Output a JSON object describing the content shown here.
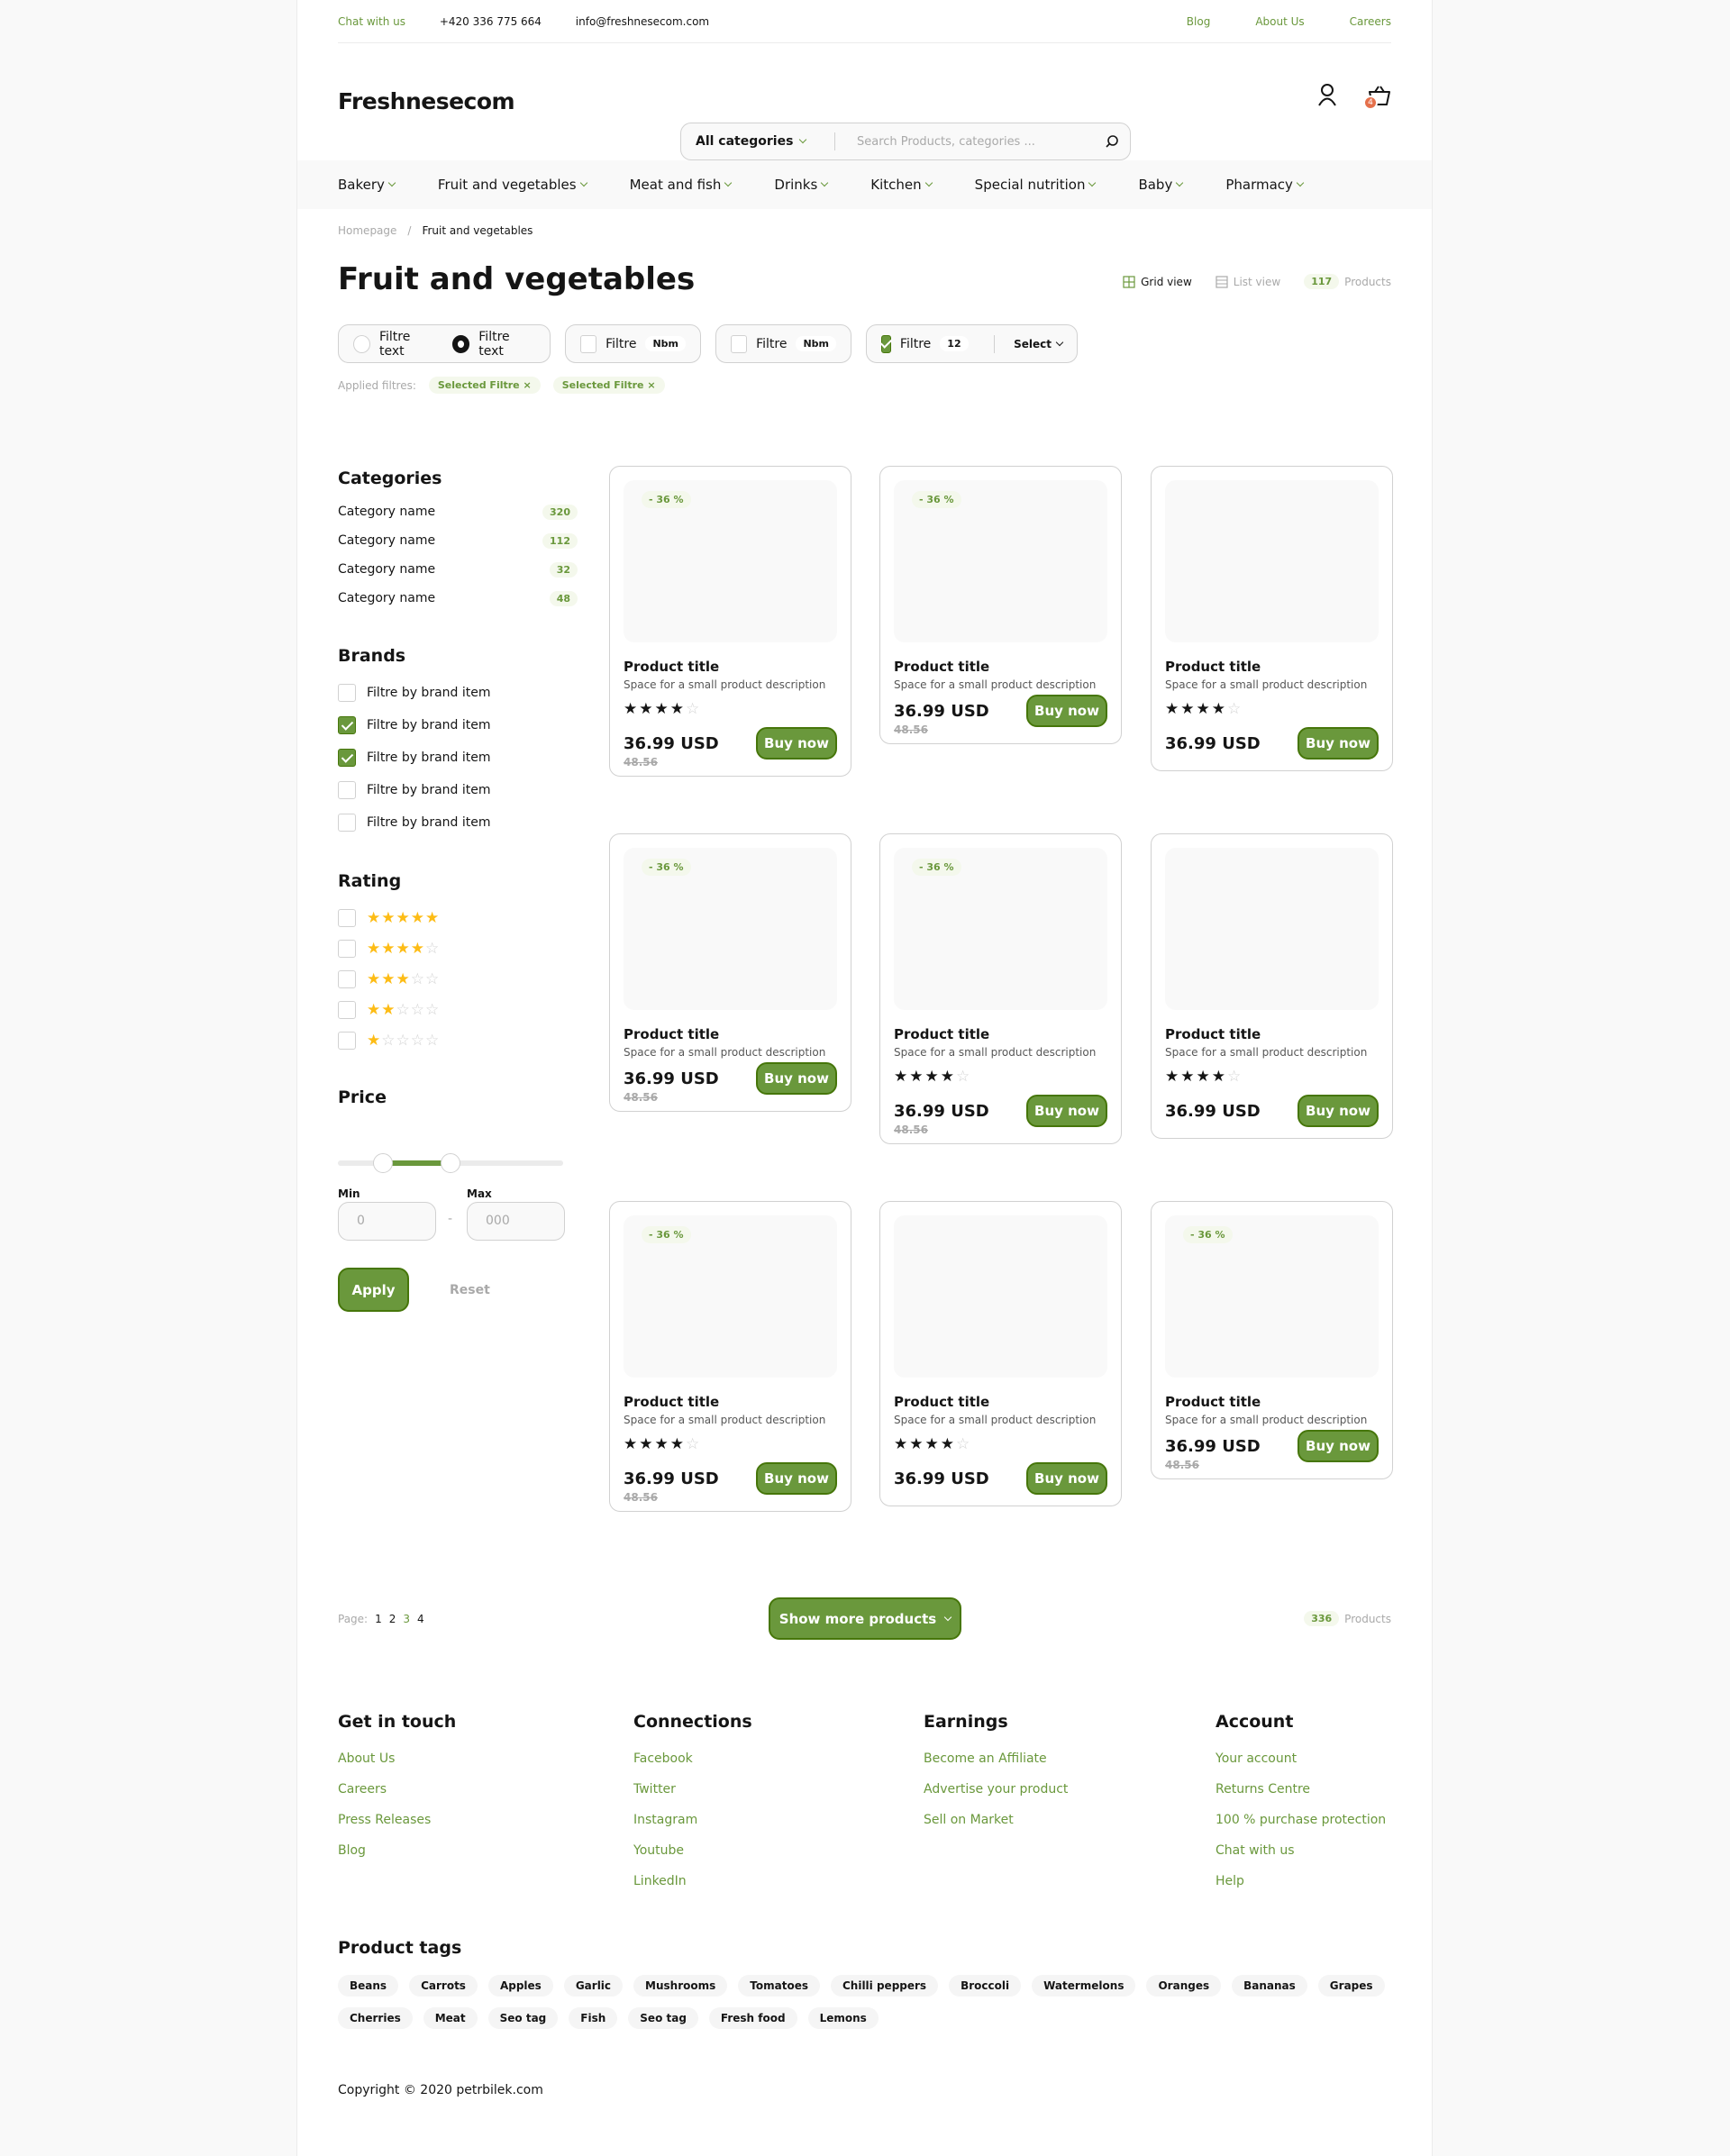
{
  "topbar": {
    "chat": "Chat with us",
    "phone": "+420 336 775 664",
    "email": "info@freshnesecom.com",
    "links": [
      "Blog",
      "About Us",
      "Careers"
    ]
  },
  "brand": "Freshnesecom",
  "search": {
    "category": "All categories",
    "placeholder": "Search Products, categories ..."
  },
  "cart_count": "4",
  "nav": [
    "Bakery",
    "Fruit and vegetables",
    "Meat and fish",
    "Drinks",
    "Kitchen",
    "Special nutrition",
    "Baby",
    "Pharmacy"
  ],
  "breadcrumb": {
    "home": "Homepage",
    "sep": "/",
    "current": "Fruit and vegetables"
  },
  "page_title": "Fruit and vegetables",
  "views": {
    "grid": "Grid view",
    "list": "List view",
    "count": "117",
    "count_label": "Products"
  },
  "filters": {
    "radio1": "Filtre text",
    "radio2": "Filtre text",
    "f1": "Filtre",
    "f1_tag": "Nbm",
    "f2": "Filtre",
    "f2_tag": "Nbm",
    "f3": "Filtre",
    "f3_tag": "12",
    "select": "Select"
  },
  "applied": {
    "label": "Applied filtres:",
    "chips": [
      "Selected Filtre",
      "Selected Filtre"
    ]
  },
  "categories": {
    "title": "Categories",
    "items": [
      {
        "name": "Category name",
        "count": "320"
      },
      {
        "name": "Category name",
        "count": "112"
      },
      {
        "name": "Category name",
        "count": "32"
      },
      {
        "name": "Category name",
        "count": "48"
      }
    ]
  },
  "brands": {
    "title": "Brands",
    "items": [
      {
        "label": "Filtre by brand item",
        "checked": false
      },
      {
        "label": "Filtre by brand item",
        "checked": true
      },
      {
        "label": "Filtre by brand item",
        "checked": true
      },
      {
        "label": "Filtre by brand item",
        "checked": false
      },
      {
        "label": "Filtre by brand item",
        "checked": false
      }
    ]
  },
  "rating": {
    "title": "Rating",
    "levels": [
      5,
      4,
      3,
      2,
      1
    ]
  },
  "price": {
    "title": "Price",
    "min_label": "Min",
    "max_label": "Max",
    "min_placeholder": "0",
    "max_placeholder": "000",
    "dash": "-",
    "apply": "Apply",
    "reset": "Reset",
    "range_from": 0.2,
    "range_to": 0.5
  },
  "products": [
    {
      "disc": "- 36 %",
      "title": "Product title",
      "desc": "Space for a small product description",
      "stars": 4,
      "price": "36.99 USD",
      "old": "48.56",
      "buy": "Buy now"
    },
    {
      "disc": "- 36 %",
      "title": "Product title",
      "desc": "Space for a small product description",
      "stars": 0,
      "price": "36.99 USD",
      "old": "48.56",
      "buy": "Buy now"
    },
    {
      "disc": "",
      "title": "Product title",
      "desc": "Space for a small product description",
      "stars": 4,
      "price": "36.99 USD",
      "old": "",
      "buy": "Buy now"
    },
    {
      "disc": "- 36 %",
      "title": "Product title",
      "desc": "Space for a small product description",
      "stars": 0,
      "price": "36.99 USD",
      "old": "48.56",
      "buy": "Buy now"
    },
    {
      "disc": "- 36 %",
      "title": "Product title",
      "desc": "Space for a small product description",
      "stars": 4,
      "price": "36.99 USD",
      "old": "48.56",
      "buy": "Buy now"
    },
    {
      "disc": "",
      "title": "Product title",
      "desc": "Space for a small product description",
      "stars": 4,
      "price": "36.99 USD",
      "old": "",
      "buy": "Buy now"
    },
    {
      "disc": "- 36 %",
      "title": "Product title",
      "desc": "Space for a small product description",
      "stars": 4,
      "price": "36.99 USD",
      "old": "48.56",
      "buy": "Buy now"
    },
    {
      "disc": "",
      "title": "Product title",
      "desc": "Space for a small product description",
      "stars": 4,
      "price": "36.99 USD",
      "old": "",
      "buy": "Buy now"
    },
    {
      "disc": "- 36 %",
      "title": "Product title",
      "desc": "Space for a small product description",
      "stars": 0,
      "price": "36.99 USD",
      "old": "48.56",
      "buy": "Buy now"
    }
  ],
  "pagination": {
    "label": "Page:",
    "pages": [
      "1",
      "2",
      "3",
      "4"
    ],
    "show_more": "Show more products",
    "count": "336",
    "count_label": "Products"
  },
  "footer": {
    "cols": [
      {
        "title": "Get in touch",
        "links": [
          "About Us",
          "Careers",
          "Press Releases",
          "Blog"
        ]
      },
      {
        "title": "Connections",
        "links": [
          "Facebook",
          "Twitter",
          "Instagram",
          "Youtube",
          "LinkedIn"
        ]
      },
      {
        "title": "Earnings",
        "links": [
          "Become an Affiliate",
          "Advertise your product",
          "Sell on Market"
        ]
      },
      {
        "title": "Account",
        "links": [
          "Your account",
          "Returns Centre",
          "100 % purchase protection",
          "Chat with us",
          "Help"
        ]
      }
    ],
    "tags_title": "Product tags",
    "tags": [
      "Beans",
      "Carrots",
      "Apples",
      "Garlic",
      "Mushrooms",
      "Tomatoes",
      "Chilli peppers",
      "Broccoli",
      "Watermelons",
      "Oranges",
      "Bananas",
      "Grapes",
      "Cherries",
      "Meat",
      "Seo tag",
      "Fish",
      "Seo tag",
      "Fresh food",
      "Lemons"
    ],
    "copyright": "Copyright © 2020 petrbilek.com"
  },
  "colors": {
    "accent": "#6a983c",
    "accent_dark": "#46760a",
    "badge_bg": "#f4f8ec",
    "star": "#fdbc15",
    "cart_badge": "#e5704b"
  },
  "icons": [
    "user-icon",
    "basket-icon",
    "search-icon",
    "grid-icon",
    "list-icon",
    "chevron-down-icon",
    "star-icon",
    "close-icon"
  ]
}
